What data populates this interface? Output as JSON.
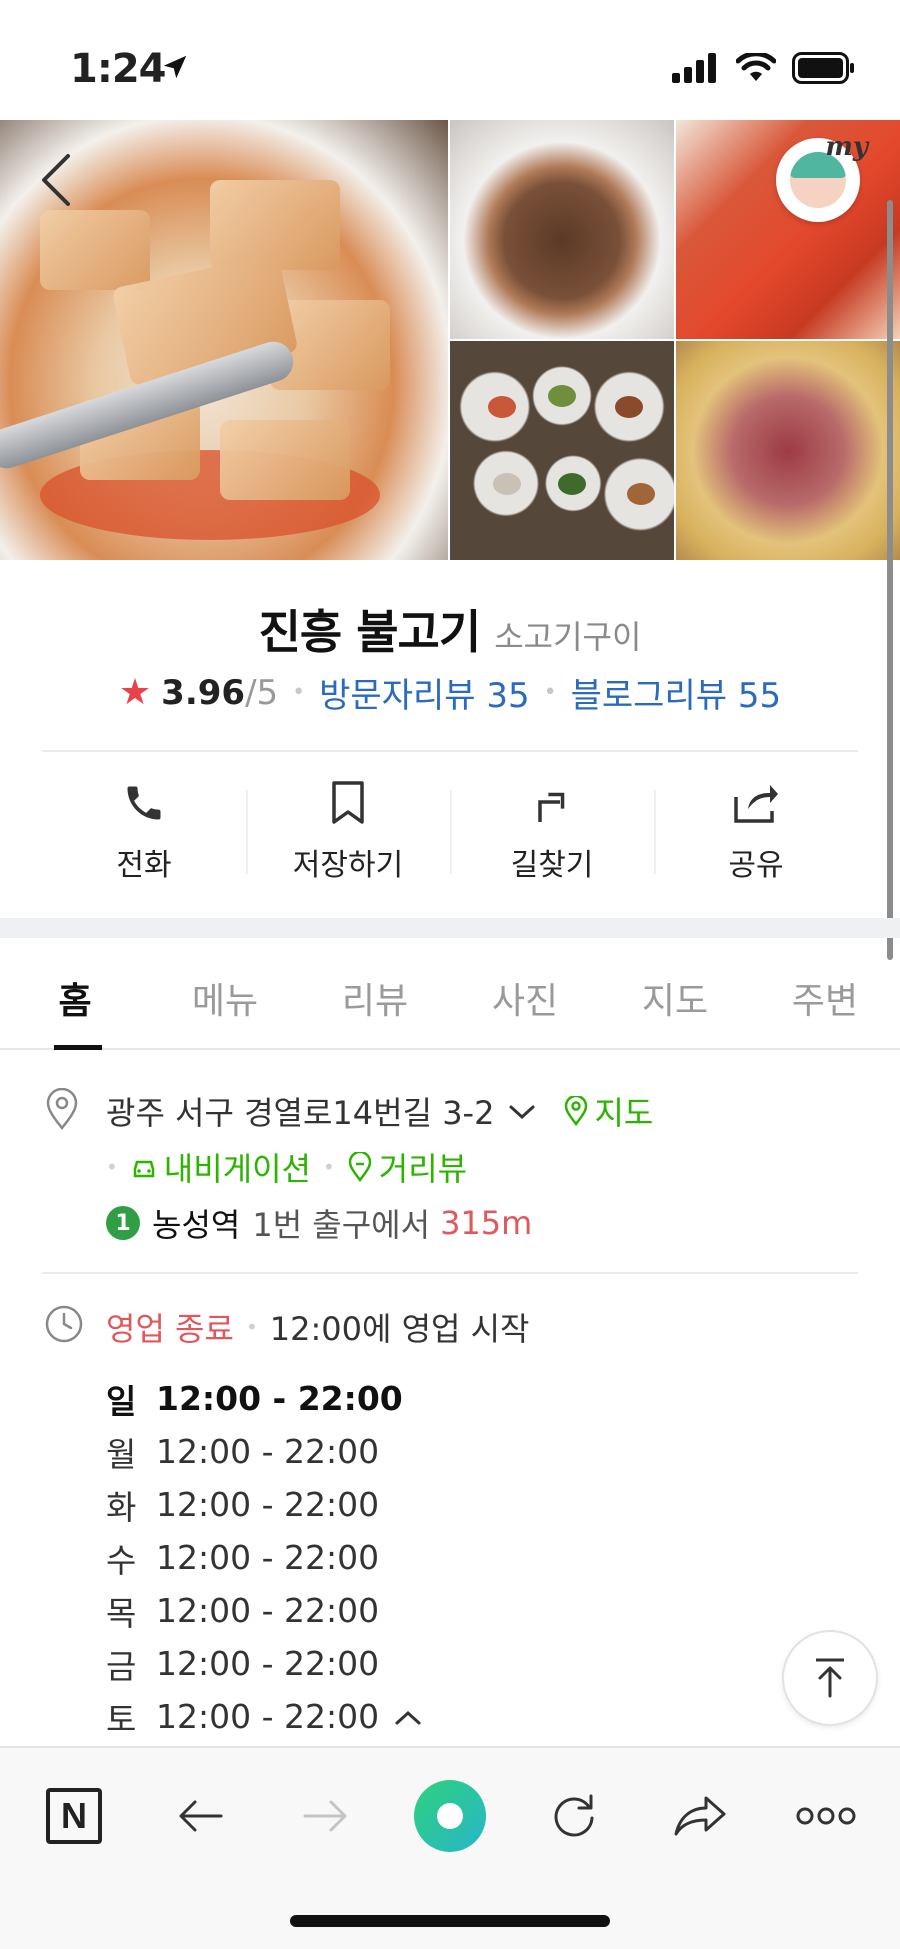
{
  "status_bar": {
    "time": "1:24",
    "icons": [
      "location-arrow-icon",
      "signal-icon",
      "wifi-icon",
      "battery-icon"
    ]
  },
  "header": {
    "back_icon": "chevron-left-icon",
    "profile_badge": "my",
    "photos": [
      "pickled-radish-photo",
      "braised-radish-photo",
      "kimchi-photo",
      "side-dishes-photo",
      "meat-photo"
    ]
  },
  "place": {
    "name": "진흥 불고기",
    "category": "소고기구이",
    "rating": "3.96",
    "rating_max": "/5",
    "visitor_reviews": "방문자리뷰 35",
    "blog_reviews": "블로그리뷰 55"
  },
  "actions": [
    {
      "label": "전화",
      "icon": "phone-icon"
    },
    {
      "label": "저장하기",
      "icon": "bookmark-icon"
    },
    {
      "label": "길찾기",
      "icon": "directions-icon"
    },
    {
      "label": "공유",
      "icon": "share-icon"
    }
  ],
  "tabs": [
    {
      "label": "홈",
      "active": true
    },
    {
      "label": "메뉴"
    },
    {
      "label": "리뷰"
    },
    {
      "label": "사진"
    },
    {
      "label": "지도"
    },
    {
      "label": "주변"
    }
  ],
  "location": {
    "address": "광주 서구 경열로14번길 3-2",
    "map_link": "지도",
    "navigation": "내비게이션",
    "street_view": "거리뷰",
    "subway_line": "1",
    "station": "농성역",
    "exit": "1번 출구에서",
    "distance": "315m"
  },
  "hours": {
    "status": "영업 종료",
    "next_open": "12:00에 영업 시작",
    "days": [
      {
        "day": "일",
        "time": "12:00 - 22:00",
        "today": true
      },
      {
        "day": "월",
        "time": "12:00 - 22:00"
      },
      {
        "day": "화",
        "time": "12:00 - 22:00"
      },
      {
        "day": "수",
        "time": "12:00 - 22:00"
      },
      {
        "day": "목",
        "time": "12:00 - 22:00"
      },
      {
        "day": "금",
        "time": "12:00 - 22:00"
      },
      {
        "day": "토",
        "time": "12:00 - 22:00"
      }
    ]
  },
  "browser_bar": {
    "logo": "N",
    "icons": [
      "naver-logo-icon",
      "back-arrow-icon",
      "forward-arrow-icon",
      "green-dot-icon",
      "refresh-icon",
      "share-arrow-icon",
      "more-dots-icon"
    ]
  },
  "colors": {
    "star": "#e8424a",
    "link_blue": "#2a6bbd",
    "naver_green": "#2db400",
    "closed_red": "#e0585c"
  }
}
